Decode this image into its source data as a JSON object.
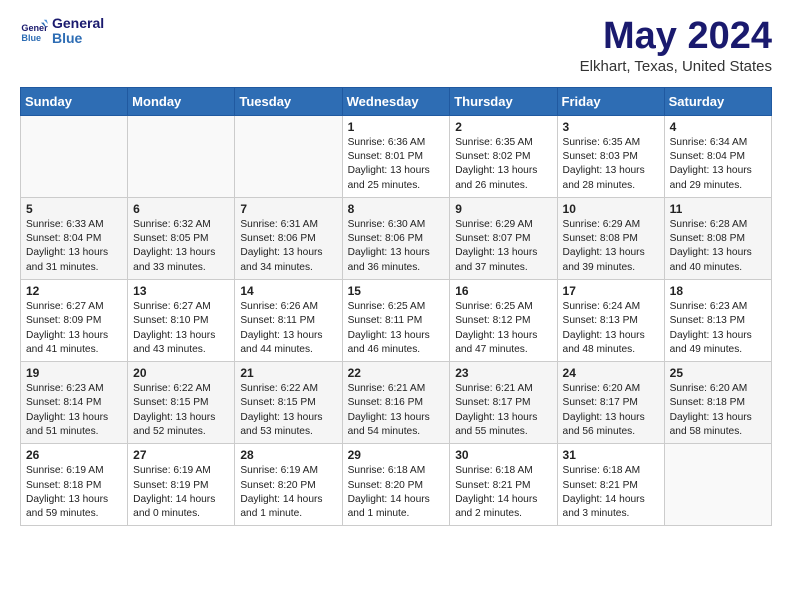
{
  "header": {
    "logo_line1": "General",
    "logo_line2": "Blue",
    "month_year": "May 2024",
    "location": "Elkhart, Texas, United States"
  },
  "weekdays": [
    "Sunday",
    "Monday",
    "Tuesday",
    "Wednesday",
    "Thursday",
    "Friday",
    "Saturday"
  ],
  "weeks": [
    [
      {
        "day": "",
        "content": ""
      },
      {
        "day": "",
        "content": ""
      },
      {
        "day": "",
        "content": ""
      },
      {
        "day": "1",
        "content": "Sunrise: 6:36 AM\nSunset: 8:01 PM\nDaylight: 13 hours\nand 25 minutes."
      },
      {
        "day": "2",
        "content": "Sunrise: 6:35 AM\nSunset: 8:02 PM\nDaylight: 13 hours\nand 26 minutes."
      },
      {
        "day": "3",
        "content": "Sunrise: 6:35 AM\nSunset: 8:03 PM\nDaylight: 13 hours\nand 28 minutes."
      },
      {
        "day": "4",
        "content": "Sunrise: 6:34 AM\nSunset: 8:04 PM\nDaylight: 13 hours\nand 29 minutes."
      }
    ],
    [
      {
        "day": "5",
        "content": "Sunrise: 6:33 AM\nSunset: 8:04 PM\nDaylight: 13 hours\nand 31 minutes."
      },
      {
        "day": "6",
        "content": "Sunrise: 6:32 AM\nSunset: 8:05 PM\nDaylight: 13 hours\nand 33 minutes."
      },
      {
        "day": "7",
        "content": "Sunrise: 6:31 AM\nSunset: 8:06 PM\nDaylight: 13 hours\nand 34 minutes."
      },
      {
        "day": "8",
        "content": "Sunrise: 6:30 AM\nSunset: 8:06 PM\nDaylight: 13 hours\nand 36 minutes."
      },
      {
        "day": "9",
        "content": "Sunrise: 6:29 AM\nSunset: 8:07 PM\nDaylight: 13 hours\nand 37 minutes."
      },
      {
        "day": "10",
        "content": "Sunrise: 6:29 AM\nSunset: 8:08 PM\nDaylight: 13 hours\nand 39 minutes."
      },
      {
        "day": "11",
        "content": "Sunrise: 6:28 AM\nSunset: 8:08 PM\nDaylight: 13 hours\nand 40 minutes."
      }
    ],
    [
      {
        "day": "12",
        "content": "Sunrise: 6:27 AM\nSunset: 8:09 PM\nDaylight: 13 hours\nand 41 minutes."
      },
      {
        "day": "13",
        "content": "Sunrise: 6:27 AM\nSunset: 8:10 PM\nDaylight: 13 hours\nand 43 minutes."
      },
      {
        "day": "14",
        "content": "Sunrise: 6:26 AM\nSunset: 8:11 PM\nDaylight: 13 hours\nand 44 minutes."
      },
      {
        "day": "15",
        "content": "Sunrise: 6:25 AM\nSunset: 8:11 PM\nDaylight: 13 hours\nand 46 minutes."
      },
      {
        "day": "16",
        "content": "Sunrise: 6:25 AM\nSunset: 8:12 PM\nDaylight: 13 hours\nand 47 minutes."
      },
      {
        "day": "17",
        "content": "Sunrise: 6:24 AM\nSunset: 8:13 PM\nDaylight: 13 hours\nand 48 minutes."
      },
      {
        "day": "18",
        "content": "Sunrise: 6:23 AM\nSunset: 8:13 PM\nDaylight: 13 hours\nand 49 minutes."
      }
    ],
    [
      {
        "day": "19",
        "content": "Sunrise: 6:23 AM\nSunset: 8:14 PM\nDaylight: 13 hours\nand 51 minutes."
      },
      {
        "day": "20",
        "content": "Sunrise: 6:22 AM\nSunset: 8:15 PM\nDaylight: 13 hours\nand 52 minutes."
      },
      {
        "day": "21",
        "content": "Sunrise: 6:22 AM\nSunset: 8:15 PM\nDaylight: 13 hours\nand 53 minutes."
      },
      {
        "day": "22",
        "content": "Sunrise: 6:21 AM\nSunset: 8:16 PM\nDaylight: 13 hours\nand 54 minutes."
      },
      {
        "day": "23",
        "content": "Sunrise: 6:21 AM\nSunset: 8:17 PM\nDaylight: 13 hours\nand 55 minutes."
      },
      {
        "day": "24",
        "content": "Sunrise: 6:20 AM\nSunset: 8:17 PM\nDaylight: 13 hours\nand 56 minutes."
      },
      {
        "day": "25",
        "content": "Sunrise: 6:20 AM\nSunset: 8:18 PM\nDaylight: 13 hours\nand 58 minutes."
      }
    ],
    [
      {
        "day": "26",
        "content": "Sunrise: 6:19 AM\nSunset: 8:18 PM\nDaylight: 13 hours\nand 59 minutes."
      },
      {
        "day": "27",
        "content": "Sunrise: 6:19 AM\nSunset: 8:19 PM\nDaylight: 14 hours\nand 0 minutes."
      },
      {
        "day": "28",
        "content": "Sunrise: 6:19 AM\nSunset: 8:20 PM\nDaylight: 14 hours\nand 1 minute."
      },
      {
        "day": "29",
        "content": "Sunrise: 6:18 AM\nSunset: 8:20 PM\nDaylight: 14 hours\nand 1 minute."
      },
      {
        "day": "30",
        "content": "Sunrise: 6:18 AM\nSunset: 8:21 PM\nDaylight: 14 hours\nand 2 minutes."
      },
      {
        "day": "31",
        "content": "Sunrise: 6:18 AM\nSunset: 8:21 PM\nDaylight: 14 hours\nand 3 minutes."
      },
      {
        "day": "",
        "content": ""
      }
    ]
  ]
}
